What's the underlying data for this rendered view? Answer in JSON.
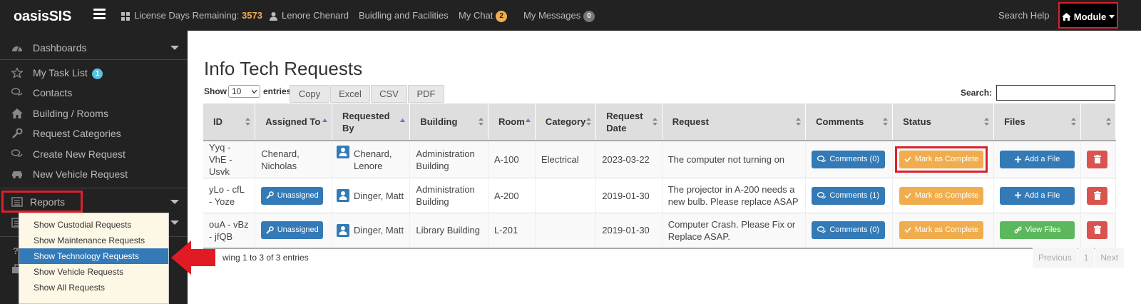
{
  "topbar": {
    "brand": "oasisSIS",
    "license_label": "License Days Remaining:",
    "license_days": "3573",
    "user_name": "Lenore Chenard",
    "building": "Buidling and Facilities",
    "chat_label": "My Chat",
    "chat_count": "2",
    "messages_label": "My Messages",
    "messages_count": "0",
    "search_help": "Search Help",
    "module_label": "Module"
  },
  "sidebar": {
    "dashboards": "Dashboards",
    "my_task_list": "My Task List",
    "task_count": "1",
    "contacts": "Contacts",
    "building_rooms": "Building / Rooms",
    "request_categories": "Request Categories",
    "create_new_request": "Create New Request",
    "new_vehicle_request": "New Vehicle Request",
    "reports": "Reports"
  },
  "dropdown": {
    "items": [
      "Show Custodial Requests",
      "Show Maintenance Requests",
      "Show Technology Requests",
      "Show Vehicle Requests",
      "Show All Requests"
    ]
  },
  "main": {
    "title": "Info Tech Requests",
    "show_label": "Show",
    "show_value": "10",
    "entries_label": "entries",
    "export_buttons": [
      "Copy",
      "Excel",
      "CSV",
      "PDF"
    ],
    "search_label": "Search:",
    "search_value": "",
    "columns": [
      "ID",
      "Assigned To",
      "Requested By",
      "Building",
      "Room",
      "Category",
      "Request Date",
      "Request",
      "Comments",
      "Status",
      "Files",
      ""
    ],
    "rows": [
      {
        "id": "Yyq - VhE - Usvk",
        "assigned": "Chenard, Nicholas",
        "requested_by": "Chenard, Lenore",
        "building": "Administration Building",
        "room": "A-100",
        "category": "Electrical",
        "date": "2023-03-22",
        "request": "The computer not turning on",
        "comments": "Comments (0)",
        "status": "Mark as Complete",
        "files": "Add a File"
      },
      {
        "id": "yLo - cfL - Yoze",
        "assigned": "Unassigned",
        "requested_by": "Dinger, Matt",
        "building": "Administration Building",
        "room": "A-200",
        "category": "",
        "date": "2019-01-30",
        "request": "The projector in A-200 needs a new bulb. Please replace ASAP",
        "comments": "Comments (1)",
        "status": "Mark as Complete",
        "files": "Add a File"
      },
      {
        "id": "ouA - vBz - jfQB",
        "assigned": "Unassigned",
        "requested_by": "Dinger, Matt",
        "building": "Library Building",
        "room": "L-201",
        "category": "",
        "date": "2019-01-30",
        "request": "Computer Crash. Please Fix or Replace ASAP.",
        "comments": "Comments (0)",
        "status": "Mark as Complete",
        "files": "View Files"
      }
    ],
    "info": "wing 1 to 3 of 3 entries",
    "pager": {
      "previous": "Previous",
      "page": "1",
      "next": "Next"
    }
  }
}
